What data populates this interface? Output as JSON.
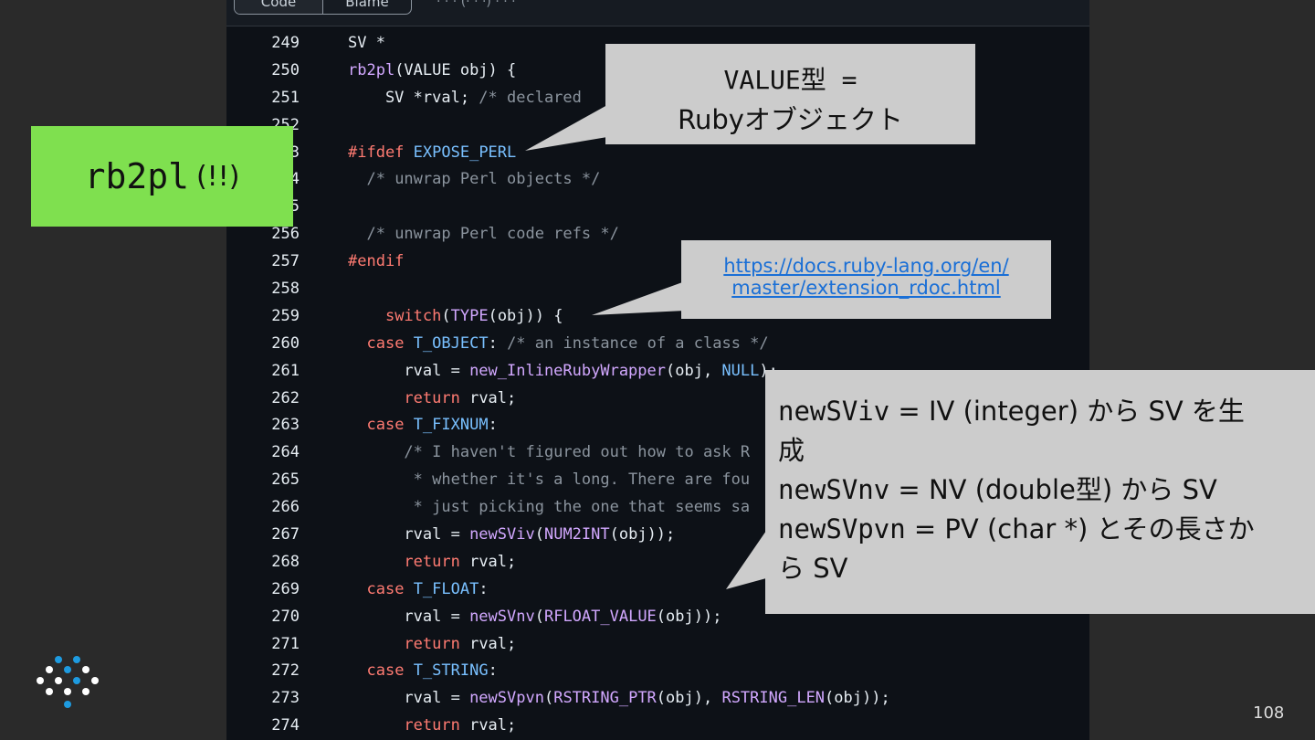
{
  "tabs": {
    "code": "Code",
    "blame": "Blame"
  },
  "breadcrumb": "· · · (· · ·) · · ·",
  "code_lines": [
    {
      "n": "249",
      "t": "SV *",
      "c": "plain"
    },
    {
      "n": "250",
      "t": "rb2pl(VALUE obj) {",
      "c": "fnline"
    },
    {
      "n": "251",
      "t": "    SV *rval; /* declared",
      "c": "decl"
    },
    {
      "n": "252",
      "t": "",
      "c": "plain"
    },
    {
      "n": "253",
      "t": "#ifdef EXPOSE_PERL",
      "c": "pp"
    },
    {
      "n": "254",
      "t": "  /* unwrap Perl objects */",
      "c": "comment"
    },
    {
      "n": "255",
      "t": "",
      "c": "plain"
    },
    {
      "n": "256",
      "t": "  /* unwrap Perl code refs */",
      "c": "comment"
    },
    {
      "n": "257",
      "t": "#endif",
      "c": "kwline"
    },
    {
      "n": "258",
      "t": "",
      "c": "plain"
    },
    {
      "n": "259",
      "t": "    switch(TYPE(obj)) {",
      "c": "switch"
    },
    {
      "n": "260",
      "t": "  case T_OBJECT: /* an instance of a class */",
      "c": "case"
    },
    {
      "n": "261",
      "t": "      rval = new_InlineRubyWrapper(obj, NULL);",
      "c": "call"
    },
    {
      "n": "262",
      "t": "      return rval;",
      "c": "ret"
    },
    {
      "n": "263",
      "t": "  case T_FIXNUM:",
      "c": "case"
    },
    {
      "n": "264",
      "t": "      /* I haven't figured out how to ask R",
      "c": "comment"
    },
    {
      "n": "265",
      "t": "       * whether it's a long. There are fou",
      "c": "comment"
    },
    {
      "n": "266",
      "t": "       * just picking the one that seems sa",
      "c": "comment"
    },
    {
      "n": "267",
      "t": "      rval = newSViv(NUM2INT(obj));",
      "c": "call"
    },
    {
      "n": "268",
      "t": "      return rval;",
      "c": "ret"
    },
    {
      "n": "269",
      "t": "  case T_FLOAT:",
      "c": "case"
    },
    {
      "n": "270",
      "t": "      rval = newSVnv(RFLOAT_VALUE(obj));",
      "c": "call"
    },
    {
      "n": "271",
      "t": "      return rval;",
      "c": "ret"
    },
    {
      "n": "272",
      "t": "  case T_STRING:",
      "c": "case"
    },
    {
      "n": "273",
      "t": "      rval = newSVpvn(RSTRING_PTR(obj), RSTRING_LEN(obj));",
      "c": "call"
    },
    {
      "n": "274",
      "t": "      return rval;",
      "c": "ret"
    }
  ],
  "callouts": {
    "value_type": {
      "line1": "VALUE型 =",
      "line2": "Rubyオブジェクト"
    },
    "docs_link": {
      "line1": "https://docs.ruby-lang.org/en/",
      "line2": "master/extension_rdoc.html"
    },
    "newsv": {
      "l1a": "newSViv",
      "l1b": " = IV (integer) から SV を生",
      "l2": "成",
      "l3a": "newSVnv",
      "l3b": " = NV (double型) から SV",
      "l4a": "newSVpvn",
      "l4b": " = PV (char *) とその長さか",
      "l5": "ら SV"
    }
  },
  "green_label": {
    "mono": "rb2pl",
    "suffix": "(!!)"
  },
  "page_number": "108",
  "colors": {
    "accent_green": "#7fe04f",
    "callout_gray": "#cccccc",
    "link_blue": "#1a6fd6",
    "logo_blue": "#1e9be0"
  }
}
